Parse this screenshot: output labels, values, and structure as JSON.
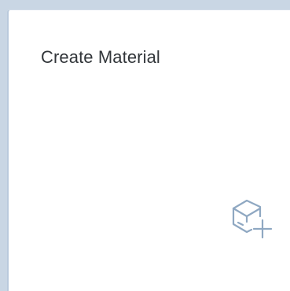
{
  "tile": {
    "title": "Create Material",
    "icon": "create-material-icon",
    "icon_color": "#8fa8c2"
  }
}
